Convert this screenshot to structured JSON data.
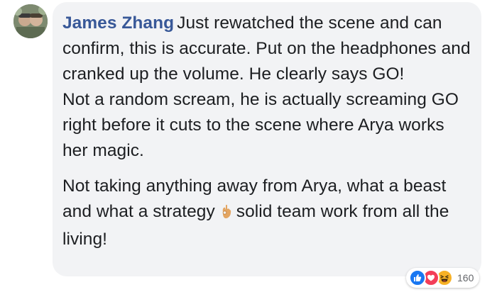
{
  "comment": {
    "author": "James Zhang",
    "paragraph1": "Just rewatched the scene and can confirm, this is accurate. Put on the headphones and cranked up the volume. He clearly says GO!",
    "paragraph2": "Not a random scream, he is actually screaming GO right before it cuts to the scene where Arya works her magic.",
    "paragraph3_before_emoji": "Not taking anything away from Arya, what a beast and what a strategy",
    "paragraph3_after_emoji": "solid team work from all the living!",
    "emoji": "ok-hand-icon"
  },
  "reactions": {
    "icons": [
      "like-icon",
      "love-icon",
      "haha-icon"
    ],
    "count": "160"
  },
  "colors": {
    "author": "#385898",
    "bubble": "#f2f3f5",
    "like": "#1877f2",
    "love": "#f33e58",
    "haha": "#f7b125"
  }
}
